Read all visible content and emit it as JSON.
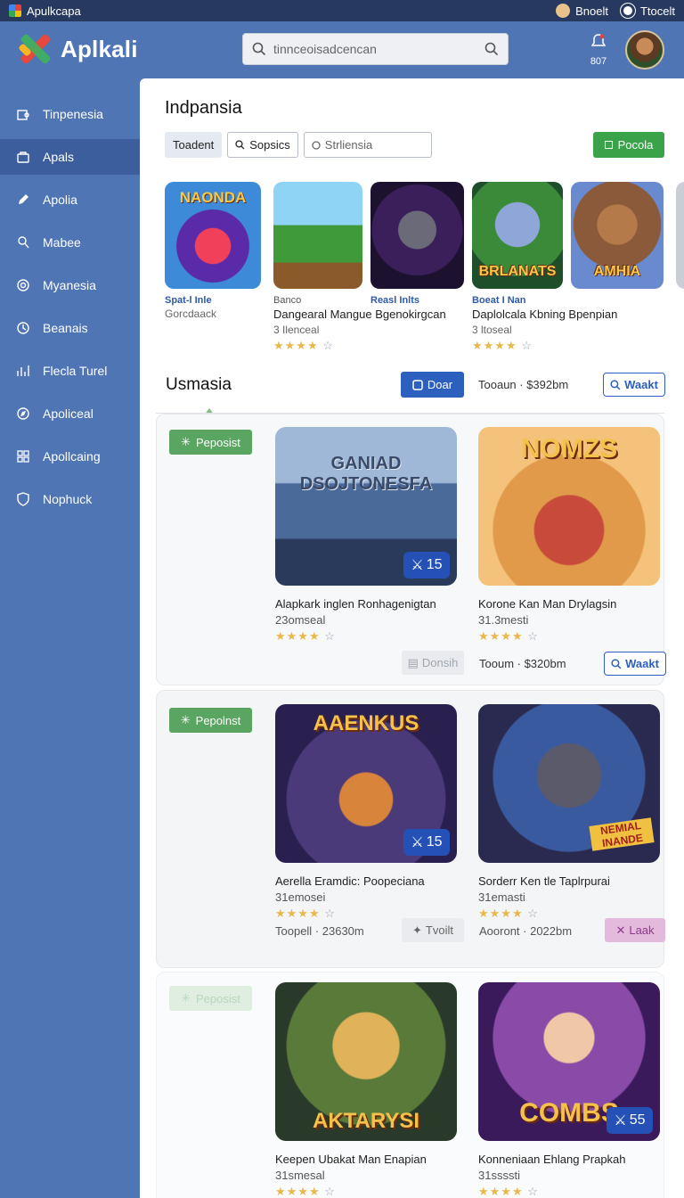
{
  "system_bar": {
    "app_name": "Apulkcapa",
    "user_label": "Bnoelt",
    "account_label": "Ttocelt"
  },
  "header": {
    "brand": "Aplkali",
    "search_placeholder": "tinnceoisadcencan",
    "notification_count": "807"
  },
  "sidebar": {
    "items": [
      {
        "label": "Tinpenesia",
        "icon": "puzzle-icon"
      },
      {
        "label": "Apals",
        "icon": "bag-icon",
        "active": true
      },
      {
        "label": "Apolia",
        "icon": "pencil-icon"
      },
      {
        "label": "Mabee",
        "icon": "user-icon"
      },
      {
        "label": "Myanesia",
        "icon": "settings-icon"
      },
      {
        "label": "Beanais",
        "icon": "clock-icon"
      },
      {
        "label": "Flecla Turel",
        "icon": "chart-icon"
      },
      {
        "label": "Apoliceal",
        "icon": "compass-icon"
      },
      {
        "label": "Apollcaing",
        "icon": "grid-icon"
      },
      {
        "label": "Nophuck",
        "icon": "shield-icon"
      }
    ]
  },
  "main": {
    "title": "Indpansia",
    "filters": {
      "tab1": "Toadent",
      "tab2": "Sopsics",
      "input_placeholder": "Strliensia"
    },
    "action_button": "Pocola",
    "carousel": [
      {
        "art_word": "NAONDA",
        "cat": "Spat-l Inle",
        "sub": "Gorcdaack",
        "title": "",
        "meta": "",
        "stars": ""
      },
      {
        "art_word": "",
        "cat": "Banco",
        "sub": "",
        "title": "Dangearal Mangue Bgenokirgcan",
        "meta": "3 Ilenceal",
        "stars": "★★★★"
      },
      {
        "art_word": "",
        "cat": "Reasl Inlts",
        "sub": "",
        "title": "",
        "meta": "",
        "stars": ""
      },
      {
        "art_word": "BRLANATS",
        "cat": "Boeat I Nan",
        "sub": "",
        "title": "Daplolcala Kbning Bpenpian",
        "meta": "3 ltoseal",
        "stars": "★★★★"
      },
      {
        "art_word": "AMHIA",
        "cat": "",
        "sub": "",
        "title": "",
        "meta": "",
        "stars": ""
      }
    ],
    "section": {
      "title": "Usmasia",
      "primary_button": "Doar",
      "price": "Tooaun · $392bm",
      "action": "Waakt"
    },
    "rows": [
      {
        "pill": "Peposist",
        "cards": [
          {
            "art_word": "GANIAD DSOJTONESFA",
            "badge": "15",
            "title": "Alapkark inglen Ronhagenigtan",
            "meta": "23omseal",
            "stars": "★★★★"
          },
          {
            "art_word": "NOMZS",
            "badge": "",
            "title": "Korone Kan Man Drylagsin",
            "meta": "31.3mesti",
            "stars": "★★★★"
          }
        ],
        "left_button": "Donsih",
        "price": "Tooum · $320bm",
        "right_button": "Waakt"
      },
      {
        "pill": "Pepolnst",
        "cards": [
          {
            "art_word": "AAENKUS",
            "badge": "15",
            "title": "Aerella Eramdic: Poopeciana",
            "meta": "31emosei",
            "stars": "★★★★"
          },
          {
            "art_word": "NEMIAL INANDE",
            "badge": "",
            "title": "Sorderr Ken tle Taplrpurai",
            "meta": "31emasti",
            "stars": "★★★★"
          }
        ],
        "left_price": "Toopell · 23630m",
        "left_button": "Tvoilt",
        "price": "Aooront · 2022bm",
        "right_button": "Laak"
      },
      {
        "pill": "Peposist",
        "cards": [
          {
            "art_word": "AKTARYSI",
            "badge": "",
            "title": "Keepen Ubakat Man Enapian",
            "meta": "31smesal",
            "stars": "★★★★"
          },
          {
            "art_word": "COMBS",
            "badge": "55",
            "title": "Konneniaan Ehlang Prapkah",
            "meta": "31ssssti",
            "stars": "★★★★"
          }
        ]
      }
    ]
  },
  "colors": {
    "sidebar_bg": "#4f75b4",
    "accent_blue": "#2d5fbf",
    "accent_green": "#3aa34a",
    "star": "#e9b84a"
  }
}
